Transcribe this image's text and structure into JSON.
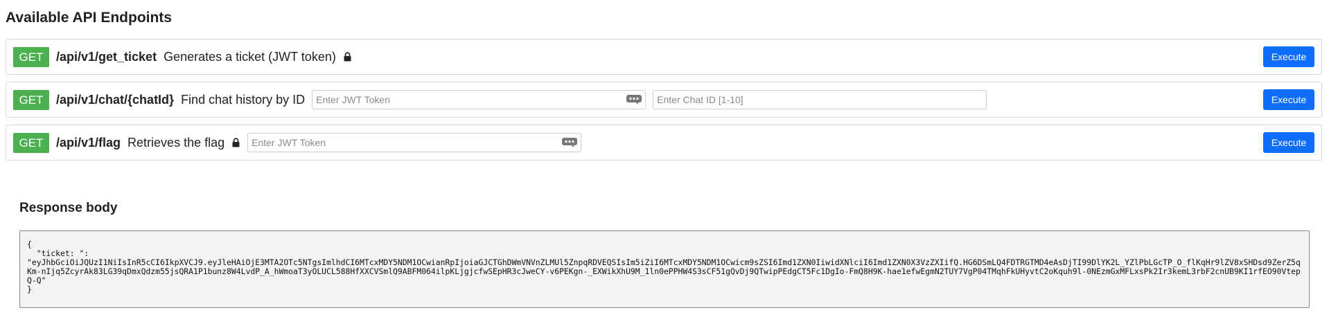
{
  "page": {
    "title": "Available API Endpoints"
  },
  "endpoints": [
    {
      "method": "GET",
      "path": "/api/v1/get_ticket",
      "description": "Generates a ticket (JWT token)",
      "locked": true,
      "execute_label": "Execute"
    },
    {
      "method": "GET",
      "path": "/api/v1/chat/{chatId}",
      "description": "Find chat history by ID",
      "locked": false,
      "jwt_placeholder": "Enter JWT Token",
      "jwt_value": "",
      "chat_id_placeholder": "Enter Chat ID [1-10]",
      "chat_id_value": "",
      "execute_label": "Execute"
    },
    {
      "method": "GET",
      "path": "/api/v1/flag",
      "description": "Retrieves the flag",
      "locked": true,
      "jwt_placeholder": "Enter JWT Token",
      "jwt_value": "",
      "execute_label": "Execute"
    }
  ],
  "response": {
    "title": "Response body",
    "body": "{\n  \"ticket: \":\n\"eyJhbGciOiJQUzI1NiIsInR5cCI6IkpXVCJ9.eyJleHAiOjE3MTA2OTc5NTgsImlhdCI6MTcxMDY5NDM1OCwianRpIjoiaGJCTGhDWmVNVnZLMUl5ZnpqRDVEQSIsIm5iZiI6MTcxMDY5NDM1OCwicm9sZSI6Imd1ZXN0IiwidXNlciI6Imd1ZXN0X3VzZXIifQ.HG6DSmLQ4FDTRGTMD4eAsDjTI99DlYK2L_YZlPbLGcTP_O_flKqHr9lZV8xSHDsd9ZerZ5qKm-nIjq5ZcyrAk83LG39qDmxQdzm55jsQRA1P1bunz8W4LvdP_A_hWmoaT3yOLUCL588HfXXCVSmlQ9ABFM064ilpKLjgjcfwSEpHR3cJweCY-v6PEKgn-_EXWikXhU9M_1ln0ePPHW4S3sCF51gQvDj9QTwipPEdgCT5Fc1DgIo-FmQ8H9K-hae1efwEgmN2TUY7VgP04TMqhFkUHyvtC2oKquh9l-0NEzmGxMFLxsPk2Ir3kemL3rbF2cnUB9KI1rfEO90VtepQ-Q\"\n}"
  },
  "colors": {
    "method_get": "#4caf50",
    "execute_button": "#0d6efd"
  },
  "icons": {
    "lock": "lock-icon",
    "password_manager": "password-dots-icon"
  }
}
